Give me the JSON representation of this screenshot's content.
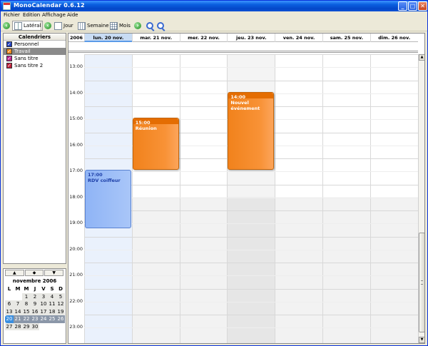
{
  "window": {
    "title": "MonoCalendar 0.6.12"
  },
  "titlebar_buttons": [
    "_",
    "□",
    "✕"
  ],
  "menu": [
    "Fichier",
    "Edition",
    "Affichage",
    "Aide"
  ],
  "toolbar": {
    "lateral": "Latéral",
    "day": "Jour",
    "week": "Semaine",
    "month": "Mois"
  },
  "sidebar": {
    "header": "Calendriers",
    "calendars": [
      {
        "name": "Personnel",
        "checked": true,
        "color": "#1f3fbf",
        "selected": false
      },
      {
        "name": "Travail",
        "checked": true,
        "color": "#f28a1d",
        "selected": true
      },
      {
        "name": "Sans titre",
        "checked": true,
        "color": "#c02090",
        "selected": false
      },
      {
        "name": "Sans titre 2",
        "checked": true,
        "color": "#c0203a",
        "selected": false
      }
    ]
  },
  "mini_calendar": {
    "nav": [
      "▲",
      "◆",
      "▼"
    ],
    "month_label": "novembre 2006",
    "weekday_headers": [
      "L",
      "M",
      "M",
      "J",
      "V",
      "S",
      "D"
    ],
    "weeks": [
      [
        "",
        "",
        "1",
        "2",
        "3",
        "4",
        "5"
      ],
      [
        "6",
        "7",
        "8",
        "9",
        "10",
        "11",
        "12"
      ],
      [
        "13",
        "14",
        "15",
        "16",
        "17",
        "18",
        "19"
      ],
      [
        "20",
        "21",
        "22",
        "23",
        "24",
        "25",
        "26"
      ],
      [
        "27",
        "28",
        "29",
        "30",
        "",
        "",
        ""
      ]
    ],
    "today": "20",
    "selected_week": 3
  },
  "week_view": {
    "year": "2006",
    "days": [
      "lun. 20 nov.",
      "mar. 21 nov.",
      "mer. 22 nov.",
      "jeu. 23 nov.",
      "ven. 24 nov.",
      "sam. 25 nov.",
      "dim. 26 nov."
    ],
    "today_index": 0,
    "hours": [
      "13:00",
      "14:00",
      "15:00",
      "16:00",
      "17:00",
      "18:00",
      "19:00",
      "20:00",
      "21:00",
      "22:00",
      "23:00"
    ],
    "events": [
      {
        "day": 0,
        "start": 17.0,
        "end": 19.25,
        "time": "17:00",
        "title": "RDV coiffeur",
        "style": "blue"
      },
      {
        "day": 1,
        "start": 15.0,
        "end": 17.0,
        "time": "15:00",
        "title": "Réunion",
        "style": "orange"
      },
      {
        "day": 3,
        "start": 14.0,
        "end": 17.0,
        "time": "14:00",
        "title": "Nouvel événement",
        "style": "orange"
      }
    ],
    "first_hour": 12.5,
    "work_end_hour": 18.0
  }
}
